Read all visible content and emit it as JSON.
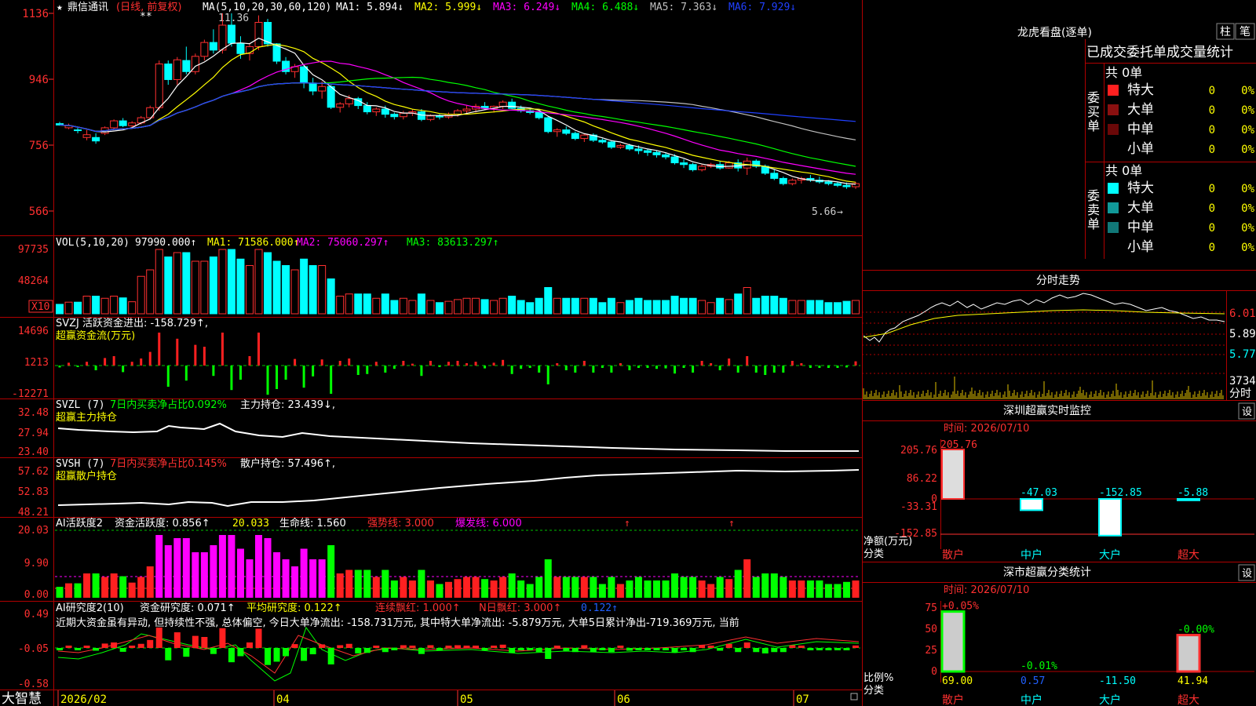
{
  "header": {
    "star": "★",
    "stock_name": "鼎信通讯",
    "period_note": "(日线, 前复权)",
    "ma_label": "MA(5,10,20,30,60,120)",
    "ma1": "MA1: 5.894↓",
    "ma2": "MA2: 5.999↓",
    "ma3": "MA3: 6.249↓",
    "ma4": "MA4: 6.488↓",
    "ma5": "MA5: 7.363↓",
    "ma6": "MA6: 7.929↓",
    "stars": "**",
    "high_marker": "11.36",
    "low_marker": "5.66"
  },
  "axes": {
    "price_ticks": [
      "1136",
      "946",
      "756",
      "566"
    ],
    "vol_ticks": [
      "97735",
      "48264"
    ],
    "vol_unit": "X10",
    "svzj_ticks": [
      "14696",
      "1213",
      "-12271"
    ],
    "svzl_ticks": [
      "32.48",
      "27.94",
      "23.40"
    ],
    "svsh_ticks": [
      "57.62",
      "52.83",
      "48.21"
    ],
    "ai2_ticks": [
      "20.03",
      "9.90",
      "0.00"
    ],
    "ai10_ticks": [
      "0.49",
      "-0.05",
      "-0.58"
    ],
    "x_labels": [
      "2026/02",
      "04",
      "05",
      "06",
      "07"
    ]
  },
  "panels": {
    "vol_header": "VOL(5,10,20)",
    "vol_v": "97990.000↑",
    "vol_ma1": "MA1: 71586.000↑",
    "vol_ma2": "MA2: 75060.297↑",
    "vol_ma3": "MA3: 83613.297↑",
    "svzj_header": "SVZJ  活跃资金进出: -158.729↑,",
    "svzj_sub": "超赢资金流(万元)",
    "svzl_header": "SVZL (7)",
    "svzl_green": "7日内买卖净占比0.092%",
    "svzl_white": "主力持仓: 23.439↓,",
    "svzl_sub": "超赢主力持仓",
    "svsh_header": "SVSH (7)",
    "svsh_red": "7日内买卖净占比0.145%",
    "svsh_white": "散户持仓: 57.496↑,",
    "svsh_sub": "超赢散户持仓",
    "ai2_header": "AI活跃度2",
    "ai2_a": "资金活跃度: 0.856↑",
    "ai2_b": "20.033",
    "ai2_c": "生命线: 1.560",
    "ai2_d": "强势线: 3.000",
    "ai2_e": "爆发线: 6.000",
    "ai10_header": "AI研究度2(10)",
    "ai10_a": "资金研究度: 0.071↑",
    "ai10_b": "平均研究度: 0.122↑",
    "ai10_c": "连续飘红: 1.000↑",
    "ai10_d": "N日飘红: 3.000↑",
    "ai10_e": "0.122↑",
    "ai10_comment": "近期大资金虽有异动, 但持续性不强, 总体偏空, 今日大单净流出: -158.731万元, 其中特大单净流出: -5.879万元, 大单5日累计净出-719.369万元, 当前"
  },
  "footer": {
    "logo": "大智慧"
  },
  "right": {
    "lhb_title": "龙虎看盘(逐单)",
    "btn_zhu": "柱",
    "btn_bi": "笔",
    "table_title": "已成交委托单成交量统计",
    "buy_label": "委买单",
    "sell_label": "委卖单",
    "buy_total": "共 0单",
    "sell_total": "共 0单",
    "rows": [
      {
        "label": "特大",
        "value": "0",
        "pct": "0%"
      },
      {
        "label": "大单",
        "value": "0",
        "pct": "0%"
      },
      {
        "label": "中单",
        "value": "0",
        "pct": "0%"
      },
      {
        "label": "小单",
        "value": "0",
        "pct": "0%"
      }
    ],
    "buy_colors": [
      "#ff2020",
      "#8a1010",
      "#6a0808",
      "#000000"
    ],
    "sell_colors": [
      "#00ffff",
      "#119999",
      "#117777",
      "#000000"
    ],
    "fenshi_title": "分时走势",
    "fenshi_ticks": [
      "6.01",
      "5.89",
      "5.77"
    ],
    "fenshi_vol": "3734",
    "fenshi_unit": "分时",
    "monitor_title": "深圳超赢实时监控",
    "monitor_btn": "设",
    "monitor_time": "时间: 2026/07/10",
    "monitor_ticks": [
      "205.76",
      "86.22",
      "0",
      "-33.31",
      "-152.85"
    ],
    "monitor_unit_1": "净额(万元)",
    "monitor_unit_2": "分类",
    "categories": [
      "散户",
      "中户",
      "大户",
      "超大"
    ],
    "monitor_values": [
      "205.76",
      "-47.03",
      "-152.85",
      "-5.88"
    ],
    "stat_title": "深市超赢分类统计",
    "stat_btn": "设",
    "stat_time": "时间: 2026/07/10",
    "stat_ticks": [
      "75",
      "50",
      "25",
      "0"
    ],
    "stat_top": [
      "+0.05%",
      "-0.01%",
      "",
      "-0.00%"
    ],
    "stat_bottom": [
      "69.00",
      "0.57",
      "-11.50",
      "41.94"
    ],
    "stat_unit_1": "比例%",
    "stat_unit_2": "分类"
  },
  "chart_data": {
    "type": "candlestick",
    "price_ylim": [
      566,
      1136
    ],
    "candles_estimated": [
      [
        818,
        823,
        812,
        814
      ],
      [
        806,
        818,
        802,
        812
      ],
      [
        800,
        806,
        790,
        798
      ],
      [
        778,
        800,
        770,
        786
      ],
      [
        778,
        790,
        760,
        768
      ],
      [
        790,
        810,
        785,
        806
      ],
      [
        806,
        830,
        800,
        826
      ],
      [
        826,
        834,
        808,
        812
      ],
      [
        812,
        825,
        808,
        820
      ],
      [
        820,
        840,
        815,
        835
      ],
      [
        835,
        870,
        830,
        864
      ],
      [
        864,
        1000,
        855,
        990
      ],
      [
        990,
        1000,
        930,
        945
      ],
      [
        945,
        1010,
        930,
        1002
      ],
      [
        1000,
        1040,
        960,
        968
      ],
      [
        968,
        1020,
        960,
        1012
      ],
      [
        1012,
        1060,
        1000,
        1052
      ],
      [
        1052,
        1090,
        1020,
        1030
      ],
      [
        1030,
        1136,
        1020,
        1102
      ],
      [
        1102,
        1136,
        1040,
        1050
      ],
      [
        1050,
        1070,
        1005,
        1020
      ],
      [
        1020,
        1050,
        1000,
        1040
      ],
      [
        1040,
        1130,
        1030,
        1110
      ],
      [
        1110,
        1120,
        1040,
        1048
      ],
      [
        1048,
        1050,
        990,
        998
      ],
      [
        998,
        1010,
        960,
        968
      ],
      [
        968,
        990,
        950,
        982
      ],
      [
        982,
        985,
        920,
        935
      ],
      [
        935,
        950,
        900,
        912
      ],
      [
        912,
        940,
        890,
        925
      ],
      [
        925,
        930,
        860,
        865
      ],
      [
        865,
        880,
        850,
        875
      ],
      [
        875,
        900,
        865,
        890
      ],
      [
        890,
        895,
        860,
        870
      ],
      [
        870,
        880,
        845,
        852
      ],
      [
        852,
        865,
        840,
        860
      ],
      [
        860,
        870,
        835,
        845
      ],
      [
        845,
        850,
        830,
        838
      ],
      [
        838,
        855,
        830,
        848
      ],
      [
        848,
        860,
        840,
        852
      ],
      [
        852,
        860,
        825,
        830
      ],
      [
        830,
        845,
        825,
        840
      ],
      [
        840,
        845,
        830,
        837
      ],
      [
        837,
        850,
        832,
        845
      ],
      [
        845,
        860,
        838,
        855
      ],
      [
        855,
        870,
        845,
        860
      ],
      [
        860,
        875,
        850,
        868
      ],
      [
        868,
        880,
        858,
        862
      ],
      [
        862,
        870,
        850,
        868
      ],
      [
        868,
        885,
        860,
        880
      ],
      [
        880,
        890,
        860,
        862
      ],
      [
        862,
        870,
        850,
        855
      ],
      [
        855,
        860,
        845,
        850
      ],
      [
        850,
        855,
        830,
        835
      ],
      [
        835,
        840,
        790,
        795
      ],
      [
        795,
        805,
        780,
        800
      ],
      [
        800,
        810,
        785,
        790
      ],
      [
        790,
        795,
        770,
        775
      ],
      [
        775,
        790,
        765,
        785
      ],
      [
        785,
        790,
        765,
        770
      ],
      [
        770,
        775,
        760,
        765
      ],
      [
        765,
        770,
        745,
        750
      ],
      [
        750,
        760,
        745,
        755
      ],
      [
        755,
        760,
        740,
        745
      ],
      [
        745,
        755,
        730,
        740
      ],
      [
        740,
        745,
        725,
        735
      ],
      [
        735,
        740,
        720,
        728
      ],
      [
        728,
        735,
        715,
        722
      ],
      [
        722,
        730,
        700,
        705
      ],
      [
        705,
        715,
        690,
        700
      ],
      [
        700,
        705,
        680,
        685
      ],
      [
        685,
        700,
        680,
        695
      ],
      [
        695,
        705,
        690,
        700
      ],
      [
        700,
        710,
        685,
        690
      ],
      [
        690,
        710,
        688,
        705
      ],
      [
        705,
        715,
        680,
        690
      ],
      [
        690,
        720,
        670,
        710
      ],
      [
        710,
        715,
        690,
        695
      ],
      [
        695,
        700,
        670,
        675
      ],
      [
        675,
        685,
        655,
        660
      ],
      [
        660,
        665,
        640,
        645
      ],
      [
        645,
        660,
        640,
        655
      ],
      [
        655,
        665,
        645,
        660
      ],
      [
        660,
        670,
        650,
        655
      ],
      [
        655,
        665,
        645,
        650
      ],
      [
        650,
        655,
        640,
        645
      ],
      [
        645,
        650,
        635,
        640
      ],
      [
        640,
        648,
        630,
        636
      ],
      [
        636,
        650,
        630,
        645
      ]
    ],
    "ma_labels": [
      "MA1",
      "MA2",
      "MA3",
      "MA4",
      "MA5",
      "MA6"
    ],
    "ma_current": [
      5.894,
      5.999,
      6.249,
      6.488,
      7.363,
      7.929
    ],
    "volume_ylim": [
      0,
      97735
    ],
    "volume_latest": 97990.0,
    "monitor_net_wan": [
      205.76,
      -47.03,
      -152.85,
      -5.88
    ],
    "stat_ratio_pct": [
      69.0,
      0.57,
      -11.5,
      41.94
    ]
  }
}
